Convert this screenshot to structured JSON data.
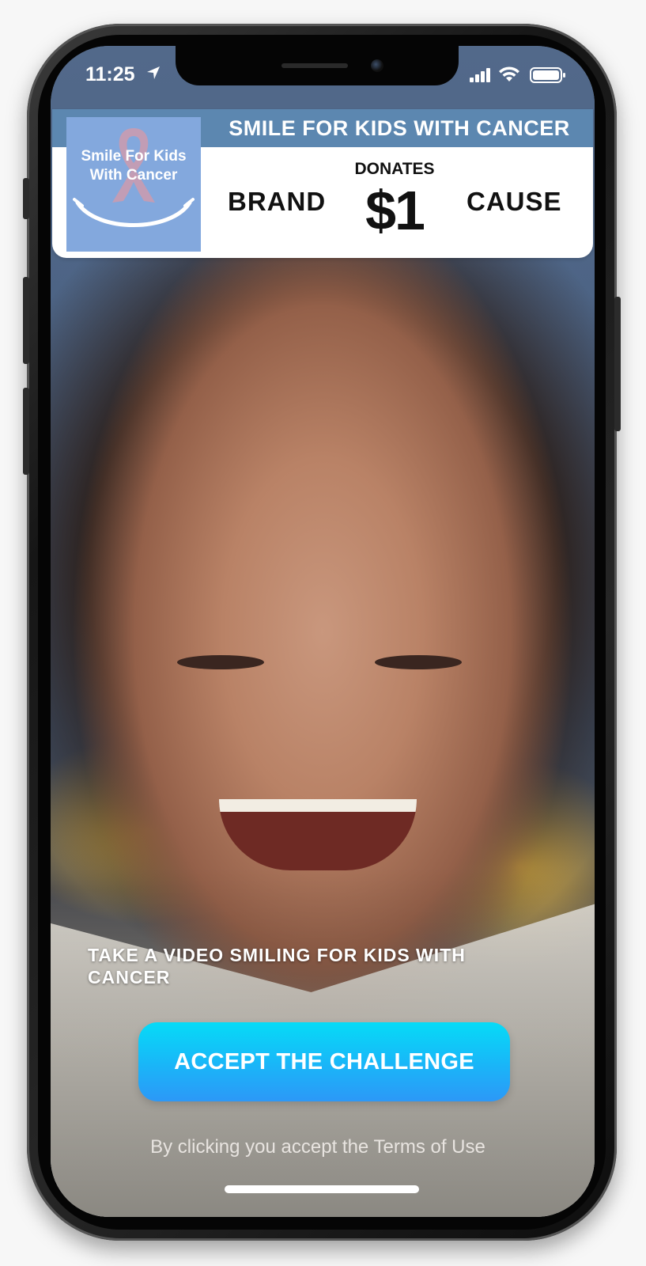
{
  "status_bar": {
    "time": "11:25",
    "icons": [
      "location-arrow-icon",
      "signal-icon",
      "wifi-icon",
      "battery-icon"
    ]
  },
  "banner": {
    "title": "SMILE FOR KIDS WITH CANCER",
    "logo_line1": "Smile For Kids",
    "logo_line2": "With Cancer",
    "brand_label": "BRAND",
    "donates_label": "DONATES",
    "amount": "$1",
    "cause_label": "CAUSE"
  },
  "main": {
    "challenge_text": "TAKE A VIDEO SMILING FOR KIDS WITH CANCER",
    "cta_label": "ACCEPT THE CHALLENGE",
    "terms_text": "By clicking you accept the Terms of Use"
  },
  "colors": {
    "banner_strip": "#5c87b0",
    "logo_background": "#83a8dd",
    "cta_gradient_top": "#06dbf7",
    "cta_gradient_bottom": "#2c98f7"
  }
}
